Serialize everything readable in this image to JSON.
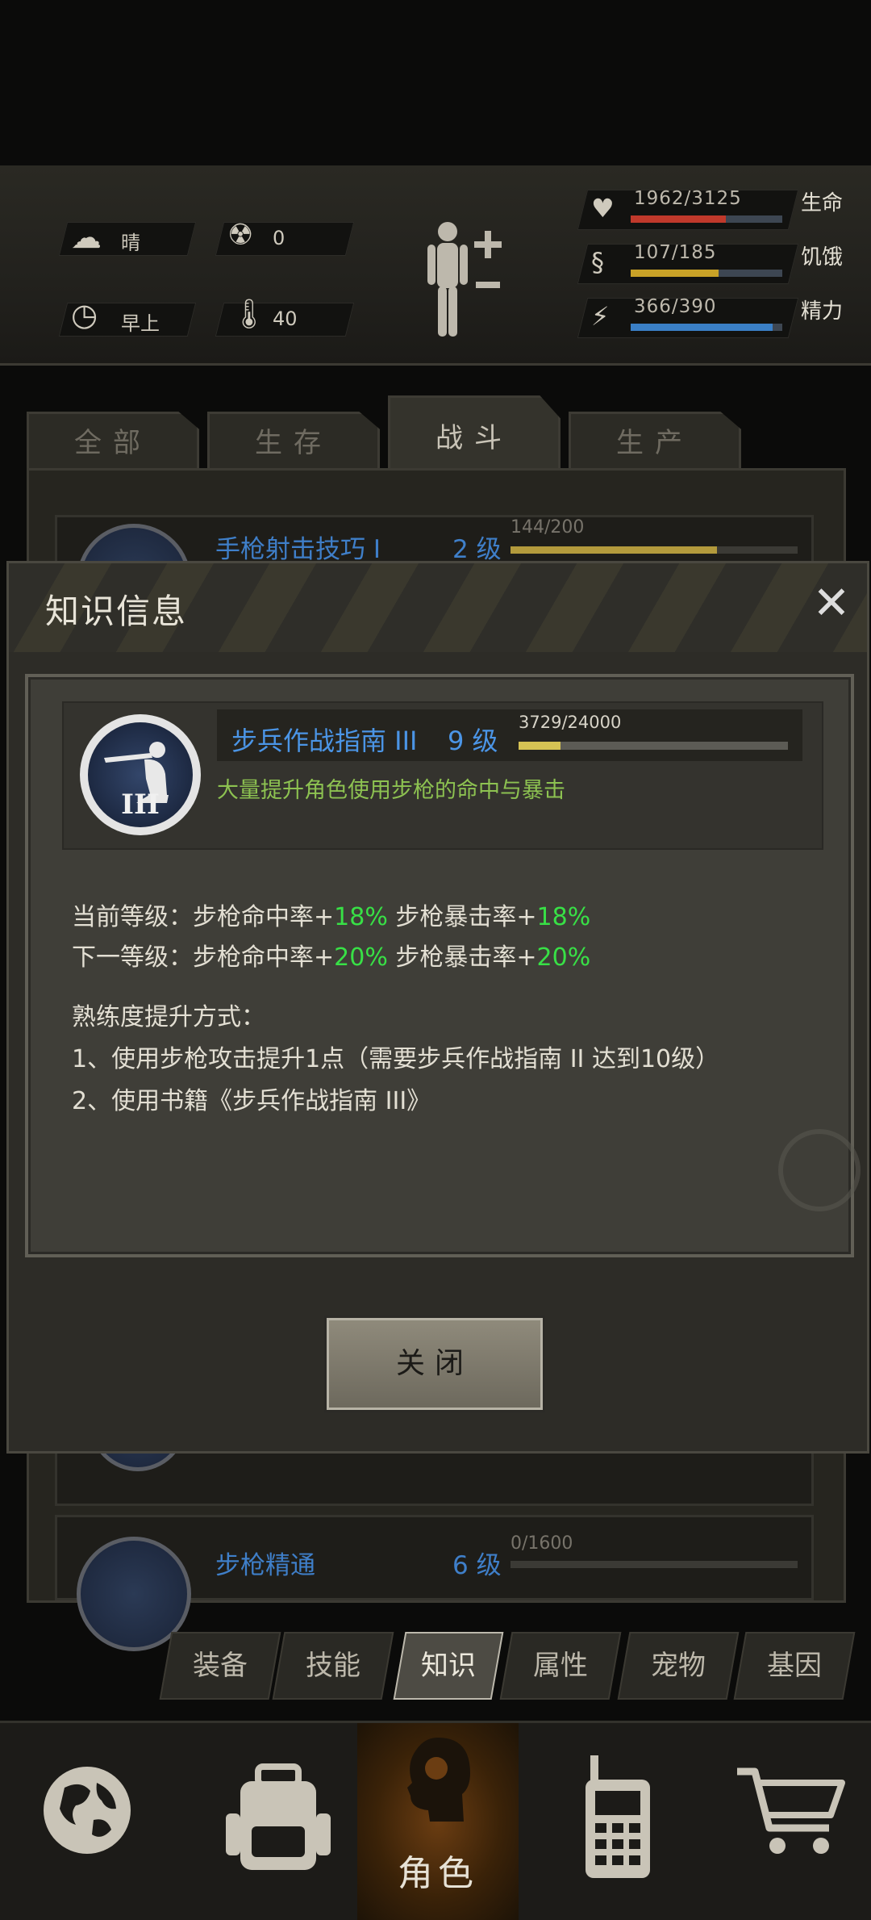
{
  "hud": {
    "weather": "晴",
    "radiation": "0",
    "time_of_day": "早上",
    "temperature": "40",
    "stats": [
      {
        "label": "生命",
        "value": "1962/3125",
        "fraction": 0.628,
        "color": "#c0392b"
      },
      {
        "label": "饥饿",
        "value": "107/185",
        "fraction": 0.578,
        "color": "#c9a227"
      },
      {
        "label": "精力",
        "value": "366/390",
        "fraction": 0.938,
        "color": "#3a7fc6"
      }
    ]
  },
  "tabs": [
    "全部",
    "生存",
    "战斗",
    "生产"
  ],
  "active_tab": "战斗",
  "skills": [
    {
      "name": "手枪射击技巧 I",
      "level": "2 级",
      "exp": "144/200",
      "fraction": 0.72
    },
    {
      "name": "步枪精通",
      "level": "6 级",
      "exp": "0/1600",
      "fraction": 0.0
    }
  ],
  "dialog": {
    "title": "知识信息",
    "item_name": "步兵作战指南 III",
    "item_level": "9 级",
    "item_exp": "3729/24000",
    "item_fraction": 0.155,
    "emblem_numeral": "III",
    "item_desc": "大量提升角色使用步枪的命中与暴击",
    "current_prefix": "当前等级：步枪命中率+",
    "current_hit": "18%",
    "current_mid": "  步枪暴击率+",
    "current_crit": "18%",
    "next_prefix": "下一等级：步枪命中率+",
    "next_hit": "20%",
    "next_mid": "  步枪暴击率+",
    "next_crit": "20%",
    "method_title": "熟练度提升方式：",
    "method_1": "1、使用步枪攻击提升1点（需要步兵作战指南 II 达到10级）",
    "method_2": "2、使用书籍《步兵作战指南 III》",
    "close_label": "关闭"
  },
  "subtabs": [
    "装备",
    "技能",
    "知识",
    "属性",
    "宠物",
    "基因"
  ],
  "active_subtab": "知识",
  "bottom_nav": [
    {
      "icon": "globe-icon",
      "label": ""
    },
    {
      "icon": "backpack-icon",
      "label": ""
    },
    {
      "icon": "character-head-icon",
      "label": "角色"
    },
    {
      "icon": "radio-icon",
      "label": ""
    },
    {
      "icon": "shopping-cart-icon",
      "label": ""
    }
  ]
}
